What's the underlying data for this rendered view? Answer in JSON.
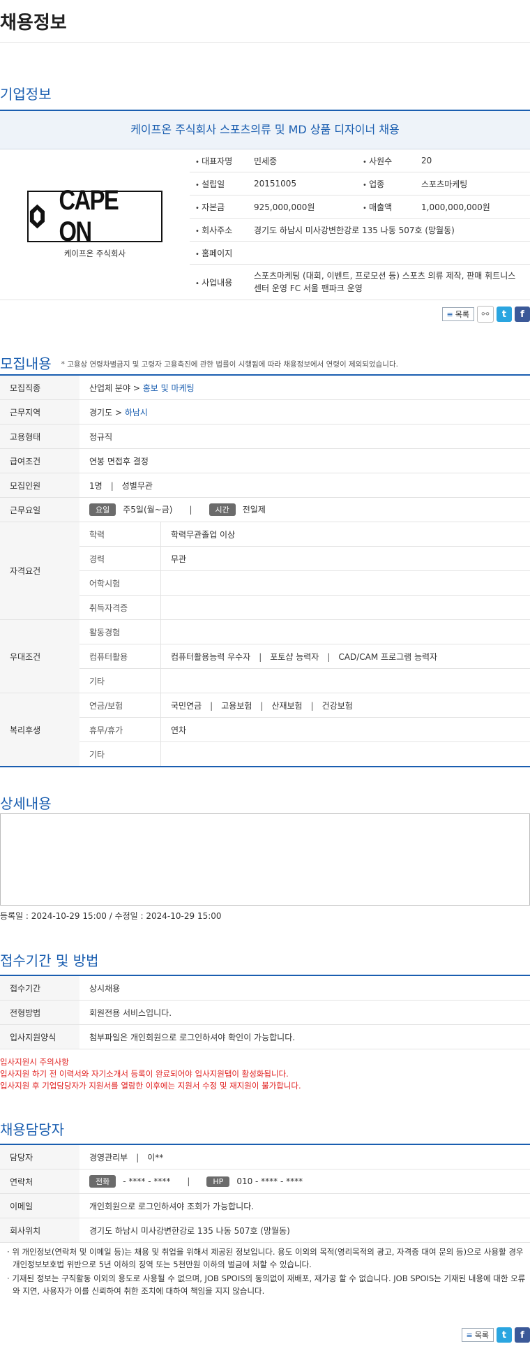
{
  "page_title": "채용정보",
  "company_section": {
    "title": "기업정보",
    "banner": "케이프온 주식회사 스포츠의류 및 MD 상품 디자이너 채용",
    "logo_text": "CAPE ON",
    "company_name": "케이프온 주식회사",
    "fields": {
      "ceo_label": "대표자명",
      "ceo": "민세중",
      "employees_label": "사원수",
      "employees": "20",
      "founded_label": "설립일",
      "founded": "20151005",
      "industry_label": "업종",
      "industry": "스포츠마케팅",
      "capital_label": "자본금",
      "capital": "925,000,000원",
      "sales_label": "매출액",
      "sales": "1,000,000,000원",
      "address_label": "회사주소",
      "address": "경기도 하남시 미사강변한강로 135 나동 507호 (망월동)",
      "homepage_label": "홈페이지",
      "homepage": "",
      "business_label": "사업내용",
      "business": "스포츠마케팅 (대회, 이벤트, 프로모션 등) 스포츠 의류 제작, 판매 휘트니스 센터 운영 FC 서울 팬파크 운영"
    },
    "list_button": "목록"
  },
  "recruit_section": {
    "title": "모집내용",
    "note": "* 고용상 연령차별금지 및 고령자 고용촉진에 관한 법률이 시행됨에 따라 채용정보에서 연령이 제외되었습니다.",
    "job_label": "모집직종",
    "job_prefix": "산업체 분야",
    "job_link": "홍보 및 마케팅",
    "region_label": "근무지역",
    "region_prefix": "경기도",
    "region_link": "하남시",
    "type_label": "고용형태",
    "type": "정규직",
    "salary_label": "급여조건",
    "salary": "연봉 면접후 결정",
    "headcount_label": "모집인원",
    "headcount": "1명",
    "gender": "성별무관",
    "days_label": "근무요일",
    "day_badge": "요일",
    "days": "주5일(월~금)",
    "time_badge": "시간",
    "time": "전일제",
    "qual_label": "자격요건",
    "qual": [
      {
        "k": "학력",
        "v": "학력무관졸업 이상"
      },
      {
        "k": "경력",
        "v": "무관"
      },
      {
        "k": "어학시험",
        "v": ""
      },
      {
        "k": "취득자격증",
        "v": ""
      }
    ],
    "pref_label": "우대조건",
    "pref": [
      {
        "k": "활동경험",
        "v": ""
      },
      {
        "k": "컴퓨터활용",
        "v1": "컴퓨터활용능력 우수자",
        "v2": "포토샵 능력자",
        "v3": "CAD/CAM 프로그램 능력자"
      },
      {
        "k": "기타",
        "v": ""
      }
    ],
    "welfare_label": "복리후생",
    "welfare": [
      {
        "k": "연금/보험",
        "v1": "국민연금",
        "v2": "고용보험",
        "v3": "산재보험",
        "v4": "건강보험"
      },
      {
        "k": "휴무/휴가",
        "v": "연차"
      },
      {
        "k": "기타",
        "v": ""
      }
    ]
  },
  "detail_section": {
    "title": "상세내용",
    "dates": "등록일 : 2024-10-29 15:00 / 수정일 : 2024-10-29 15:00"
  },
  "apply_section": {
    "title": "접수기간 및 방법",
    "period_label": "접수기간",
    "period": "상시채용",
    "method_label": "전형방법",
    "method": "회원전용 서비스입니다.",
    "form_label": "입사지원양식",
    "form": "첨부파일은 개인회원으로 로그인하셔야 확인이 가능합니다.",
    "warn1": "입사지원시 주의사항",
    "warn2": "입사지원 하기 전 이력서와 자기소개서 등록이 완료되어야 입사지원탭이 활성화됩니다.",
    "warn3": "입사지원 후 기업담당자가 지원서를 열람한 이후에는 지원서 수정 및 재지원이 불가합니다."
  },
  "contact_section": {
    "title": "채용담당자",
    "manager_label": "담당자",
    "dept": "경영관리부",
    "manager": "이**",
    "phone_label": "연락처",
    "tel_badge": "전화",
    "tel": "- **** - ****",
    "hp_badge": "HP",
    "hp": "010 - **** - ****",
    "email_label": "이메일",
    "email": "개인회원으로 로그인하셔야 조회가 가능합니다.",
    "location_label": "회사위치",
    "location": "경기도 하남시 미사강변한강로 135 나동 507호 (망월동)",
    "notice1": "위 개인정보(연락처 및 이메일 등)는 채용 및 취업을 위해서 제공된 정보입니다. 용도 이외의 목적(영리목적의 광고, 자격증 대여 문의 등)으로 사용할 경우 개인정보보호법 위반으로 5년 이하의 징역 또는 5천만원 이하의 벌금에 처할 수 있습니다.",
    "notice2": "기재된 정보는 구직활동 이외의 용도로 사용될 수 없으며, JOB SPOIS의 동의없이 재배포, 재가공 할 수 없습니다. JOB SPOIS는 기재된 내용에 대한 오류와 지연, 사용자가 이를 신뢰하여 취한 조치에 대하여 책임을 지지 않습니다.",
    "list_button": "목록"
  },
  "icons": {
    "list": "list-icon",
    "link": "link-icon",
    "twitter": "twitter-icon",
    "facebook": "facebook-icon"
  },
  "colors": {
    "accent": "#1a5eb0",
    "warning": "#e01f1f",
    "badge": "#6b6b6b"
  }
}
